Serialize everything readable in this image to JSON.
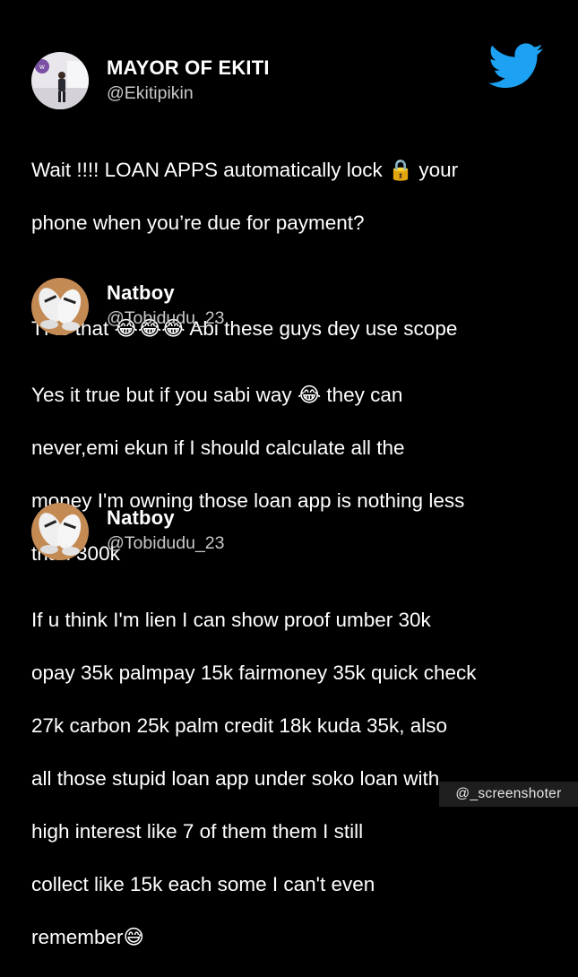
{
  "tweets": [
    {
      "name": "MAYOR OF EKITI",
      "handle": "@Ekitipikin",
      "avatar": "person-standing-avatar",
      "lines": [
        "Wait !!!! LOAN APPS automatically lock 🔒 your",
        "phone when you’re due for payment?",
        "",
        "Tf is that 😂😂😂 Abi these guys dey use scope"
      ]
    },
    {
      "name": "Natboy",
      "handle": "@Tobidudu_23",
      "avatar": "sneakers-avatar",
      "lines": [
        "Yes it true but if you sabi way 😂 they can",
        "never,emi ekun if I should calculate all the",
        "money I'm owning those loan app is nothing less",
        "than 300k"
      ]
    },
    {
      "name": "Natboy",
      "handle": "@Tobidudu_23",
      "avatar": "sneakers-avatar",
      "lines": [
        "If u think I'm lien I can show proof umber 30k",
        "opay 35k palmpay 15k fairmoney 35k quick check",
        "27k carbon 25k palm credit 18k kuda 35k, also",
        "all those stupid loan app under soko loan with",
        "high interest like 7 of them them I still",
        "collect like 15k each some I can't even",
        "remember😅"
      ]
    }
  ],
  "brand": {
    "icon": "twitter-bird-icon",
    "color": "#1DA1F2"
  },
  "watermark": "@_screenshoter"
}
